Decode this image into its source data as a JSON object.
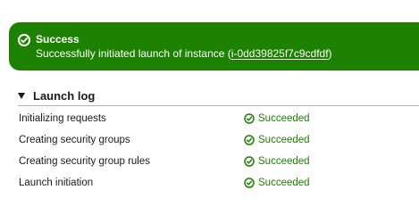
{
  "banner": {
    "icon": "check-circle-icon",
    "title": "Success",
    "message_prefix": "Successfully initiated launch of instance (",
    "instance_id": "i-0dd39825f7c9cdfdf",
    "message_suffix": ")",
    "color": "#1d8102"
  },
  "launch_log": {
    "title": "Launch log",
    "rows": [
      {
        "label": "Initializing requests",
        "status": "Succeeded"
      },
      {
        "label": "Creating security groups",
        "status": "Succeeded"
      },
      {
        "label": "Creating security group rules",
        "status": "Succeeded"
      },
      {
        "label": "Launch initiation",
        "status": "Succeeded"
      }
    ],
    "status_color": "#1d8102",
    "status_icon": "check-circle-icon"
  }
}
